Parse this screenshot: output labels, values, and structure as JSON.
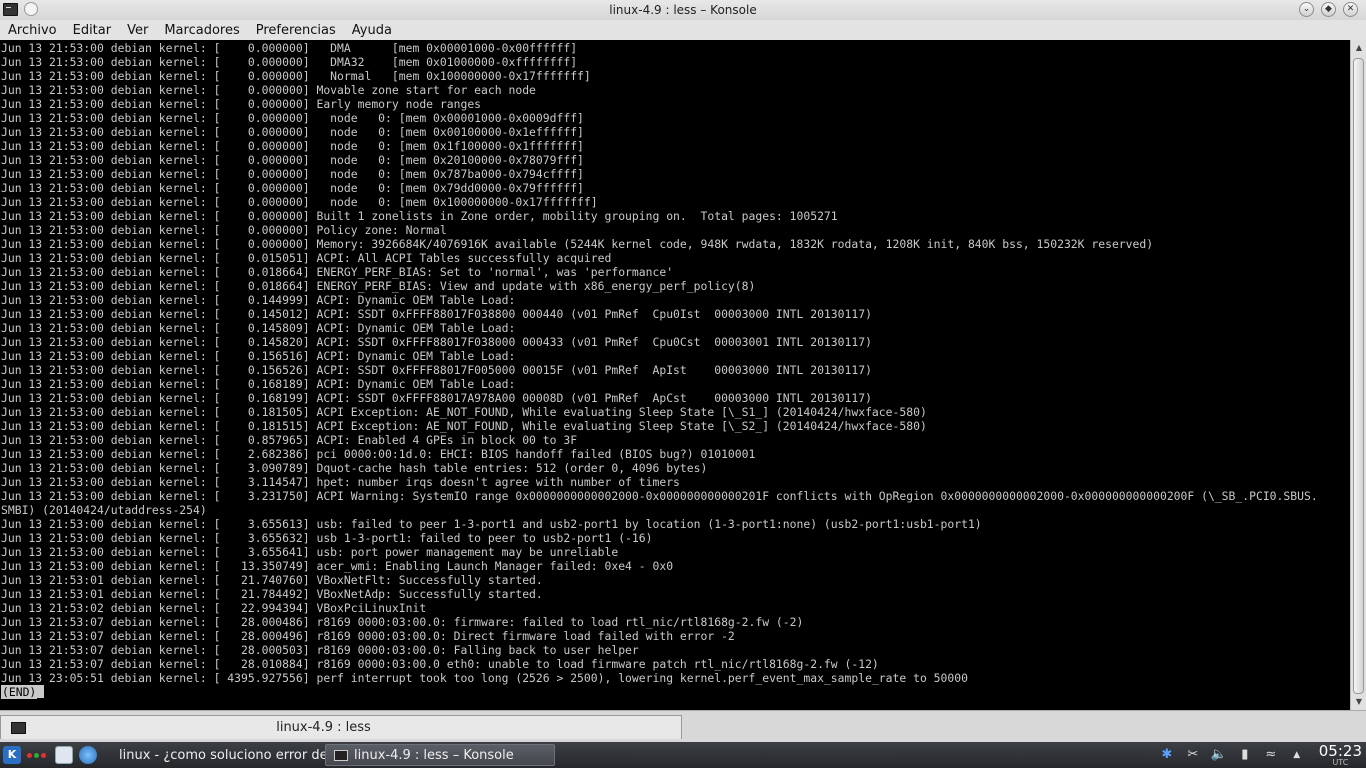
{
  "window": {
    "title": "linux-4.9 : less – Konsole"
  },
  "menu": {
    "items": [
      "Archivo",
      "Editar",
      "Ver",
      "Marcadores",
      "Preferencias",
      "Ayuda"
    ]
  },
  "terminal": {
    "lines": [
      "Jun 13 21:53:00 debian kernel: [    0.000000]   DMA      [mem 0x00001000-0x00ffffff]",
      "Jun 13 21:53:00 debian kernel: [    0.000000]   DMA32    [mem 0x01000000-0xffffffff]",
      "Jun 13 21:53:00 debian kernel: [    0.000000]   Normal   [mem 0x100000000-0x17fffffff]",
      "Jun 13 21:53:00 debian kernel: [    0.000000] Movable zone start for each node",
      "Jun 13 21:53:00 debian kernel: [    0.000000] Early memory node ranges",
      "Jun 13 21:53:00 debian kernel: [    0.000000]   node   0: [mem 0x00001000-0x0009dfff]",
      "Jun 13 21:53:00 debian kernel: [    0.000000]   node   0: [mem 0x00100000-0x1effffff]",
      "Jun 13 21:53:00 debian kernel: [    0.000000]   node   0: [mem 0x1f100000-0x1fffffff]",
      "Jun 13 21:53:00 debian kernel: [    0.000000]   node   0: [mem 0x20100000-0x78079fff]",
      "Jun 13 21:53:00 debian kernel: [    0.000000]   node   0: [mem 0x787ba000-0x794cffff]",
      "Jun 13 21:53:00 debian kernel: [    0.000000]   node   0: [mem 0x79dd0000-0x79ffffff]",
      "Jun 13 21:53:00 debian kernel: [    0.000000]   node   0: [mem 0x100000000-0x17fffffff]",
      "Jun 13 21:53:00 debian kernel: [    0.000000] Built 1 zonelists in Zone order, mobility grouping on.  Total pages: 1005271",
      "Jun 13 21:53:00 debian kernel: [    0.000000] Policy zone: Normal",
      "Jun 13 21:53:00 debian kernel: [    0.000000] Memory: 3926684K/4076916K available (5244K kernel code, 948K rwdata, 1832K rodata, 1208K init, 840K bss, 150232K reserved)",
      "Jun 13 21:53:00 debian kernel: [    0.015051] ACPI: All ACPI Tables successfully acquired",
      "Jun 13 21:53:00 debian kernel: [    0.018664] ENERGY_PERF_BIAS: Set to 'normal', was 'performance'",
      "Jun 13 21:53:00 debian kernel: [    0.018664] ENERGY_PERF_BIAS: View and update with x86_energy_perf_policy(8)",
      "Jun 13 21:53:00 debian kernel: [    0.144999] ACPI: Dynamic OEM Table Load:",
      "Jun 13 21:53:00 debian kernel: [    0.145012] ACPI: SSDT 0xFFFF88017F038800 000440 (v01 PmRef  Cpu0Ist  00003000 INTL 20130117)",
      "Jun 13 21:53:00 debian kernel: [    0.145809] ACPI: Dynamic OEM Table Load:",
      "Jun 13 21:53:00 debian kernel: [    0.145820] ACPI: SSDT 0xFFFF88017F038000 000433 (v01 PmRef  Cpu0Cst  00003001 INTL 20130117)",
      "Jun 13 21:53:00 debian kernel: [    0.156516] ACPI: Dynamic OEM Table Load:",
      "Jun 13 21:53:00 debian kernel: [    0.156526] ACPI: SSDT 0xFFFF88017F005000 00015F (v01 PmRef  ApIst    00003000 INTL 20130117)",
      "Jun 13 21:53:00 debian kernel: [    0.168189] ACPI: Dynamic OEM Table Load:",
      "Jun 13 21:53:00 debian kernel: [    0.168199] ACPI: SSDT 0xFFFF88017A978A00 00008D (v01 PmRef  ApCst    00003000 INTL 20130117)",
      "Jun 13 21:53:00 debian kernel: [    0.181505] ACPI Exception: AE_NOT_FOUND, While evaluating Sleep State [\\_S1_] (20140424/hwxface-580)",
      "Jun 13 21:53:00 debian kernel: [    0.181515] ACPI Exception: AE_NOT_FOUND, While evaluating Sleep State [\\_S2_] (20140424/hwxface-580)",
      "Jun 13 21:53:00 debian kernel: [    0.857965] ACPI: Enabled 4 GPEs in block 00 to 3F",
      "Jun 13 21:53:00 debian kernel: [    2.682386] pci 0000:00:1d.0: EHCI: BIOS handoff failed (BIOS bug?) 01010001",
      "Jun 13 21:53:00 debian kernel: [    3.090789] Dquot-cache hash table entries: 512 (order 0, 4096 bytes)",
      "Jun 13 21:53:00 debian kernel: [    3.114547] hpet: number irqs doesn't agree with number of timers",
      "Jun 13 21:53:00 debian kernel: [    3.231750] ACPI Warning: SystemIO range 0x0000000000002000-0x000000000000201F conflicts with OpRegion 0x0000000000002000-0x000000000000200F (\\_SB_.PCI0.SBUS.",
      "SMBI) (20140424/utaddress-254)",
      "Jun 13 21:53:00 debian kernel: [    3.655613] usb: failed to peer 1-3-port1 and usb2-port1 by location (1-3-port1:none) (usb2-port1:usb1-port1)",
      "Jun 13 21:53:00 debian kernel: [    3.655632] usb 1-3-port1: failed to peer to usb2-port1 (-16)",
      "Jun 13 21:53:00 debian kernel: [    3.655641] usb: port power management may be unreliable",
      "Jun 13 21:53:00 debian kernel: [   13.350749] acer_wmi: Enabling Launch Manager failed: 0xe4 - 0x0",
      "Jun 13 21:53:01 debian kernel: [   21.740760] VBoxNetFlt: Successfully started.",
      "Jun 13 21:53:01 debian kernel: [   21.784492] VBoxNetAdp: Successfully started.",
      "Jun 13 21:53:02 debian kernel: [   22.994394] VBoxPciLinuxInit",
      "Jun 13 21:53:07 debian kernel: [   28.000486] r8169 0000:03:00.0: firmware: failed to load rtl_nic/rtl8168g-2.fw (-2)",
      "Jun 13 21:53:07 debian kernel: [   28.000496] r8169 0000:03:00.0: Direct firmware load failed with error -2",
      "Jun 13 21:53:07 debian kernel: [   28.000503] r8169 0000:03:00.0: Falling back to user helper",
      "Jun 13 21:53:07 debian kernel: [   28.010884] r8169 0000:03:00.0 eth0: unable to load firmware patch rtl_nic/rtl8168g-2.fw (-12)",
      "Jun 13 23:05:51 debian kernel: [ 4395.927556] perf interrupt took too long (2526 > 2500), lowering kernel.perf_event_max_sample_rate to 50000"
    ],
    "end_marker": "(END)"
  },
  "tab": {
    "label": "linux-4.9 : less"
  },
  "taskbar": {
    "k_menu_label": "K",
    "tasks": [
      {
        "label": "linux - ¿como soluciono error de"
      },
      {
        "label": "linux-4.9 : less – Konsole"
      }
    ],
    "clock_time": "05:23",
    "clock_tz": "UTC"
  },
  "icons": {
    "app": "konsole-icon",
    "pin": "pin-icon",
    "minimize": "chevron-down-icon",
    "maximize": "maximize-icon",
    "close": "close-icon",
    "bluetooth": "bluetooth-icon",
    "clipboard": "scissors-icon",
    "volume": "volume-icon",
    "battery": "battery-icon",
    "wifi": "wifi-icon",
    "tray_expand": "tray-expand-icon"
  },
  "colors": {
    "terminal_bg": "#000000",
    "terminal_fg": "#c9c9c9",
    "taskbar_bg": "#2f3136"
  }
}
